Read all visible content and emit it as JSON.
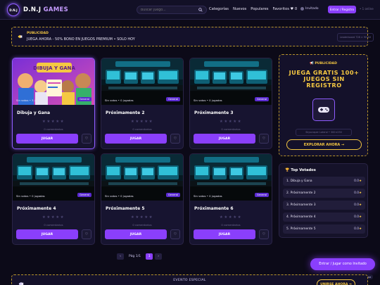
{
  "header": {
    "logo_badge": "D.N.J",
    "logo_main": "D.N.J",
    "logo_accent": "GAMES",
    "search_placeholder": "Buscar juego...",
    "nav": [
      "Categorías",
      "Nuevos",
      "Populares",
      "Favoritos ♥ 0"
    ],
    "user_label": "Invitado",
    "login_label": "Entrar / Registro",
    "online": "• 1 online"
  },
  "ad_banner": {
    "label": "PUBLICIDAD",
    "text": "JUEGA AHORA - 50% BONO EN JUEGOS PREMIUM • SOLO HOY",
    "size_label": "Leaderboard 728 × 90 AD"
  },
  "games": [
    {
      "title": "Dibuja y Gana",
      "votes": "Sin votos • 3 jugadas",
      "genre": "General",
      "stars": "★★★★★",
      "comments": "0 comentarios",
      "play": "JUGAR",
      "fav": "♡"
    },
    {
      "title": "Próximamente 2",
      "votes": "Sin votos • 0 jugadas",
      "genre": "General",
      "stars": "★★★★★",
      "comments": "0 comentarios",
      "play": "JUGAR",
      "fav": "♡"
    },
    {
      "title": "Próximamente 3",
      "votes": "Sin votos • 0 jugadas",
      "genre": "General",
      "stars": "★★★★★",
      "comments": "0 comentarios",
      "play": "JUGAR",
      "fav": "♡"
    },
    {
      "title": "Próximamente 4",
      "votes": "Sin votos • 0 jugadas",
      "genre": "General",
      "stars": "★★★★★",
      "comments": "0 comentarios",
      "play": "JUGAR",
      "fav": "♡"
    },
    {
      "title": "Próximamente 5",
      "votes": "Sin votos • 0 jugadas",
      "genre": "General",
      "stars": "★★★★★",
      "comments": "0 comentarios",
      "play": "JUGAR",
      "fav": "♡"
    },
    {
      "title": "Próximamente 6",
      "votes": "Sin votos • 0 jugadas",
      "genre": "General",
      "stars": "★★★★★",
      "comments": "0 comentarios",
      "play": "JUGAR",
      "fav": "♡"
    }
  ],
  "featured_thumb_text": "DIBUJA Y GANA",
  "pagination": {
    "prev": "‹",
    "label": "Pág 1/1",
    "page": "1",
    "next": "›"
  },
  "side_ad": {
    "label": "📢 PUBLICIDAD",
    "title": "JUEGA GRATIS 100+ JUEGOS SIN REGISTRO",
    "size_label": "Skyscraper Lateral • 300×250",
    "button": "EXPLORAR AHORA →"
  },
  "top_voted": {
    "title": "🏆 Top Votados",
    "rows": [
      {
        "name": "1. Dibuja y Gana",
        "score": "0.0"
      },
      {
        "name": "2. Próximamente 2",
        "score": "0.0"
      },
      {
        "name": "3. Próximamente 3",
        "score": "0.0"
      },
      {
        "name": "4. Próximamente 4",
        "score": "0.0"
      },
      {
        "name": "5. Próximamente 5",
        "score": "0.0"
      }
    ]
  },
  "cta_float": "Entrar / Jugar como Invitado",
  "online_pill": "1 online",
  "event": {
    "label": "EVENTO ESPECIAL",
    "button": "UNIRSE AHORA →"
  },
  "colors": {
    "accent": "#8a3ffc",
    "gold": "#f5c842",
    "background": "#0c0a18"
  }
}
